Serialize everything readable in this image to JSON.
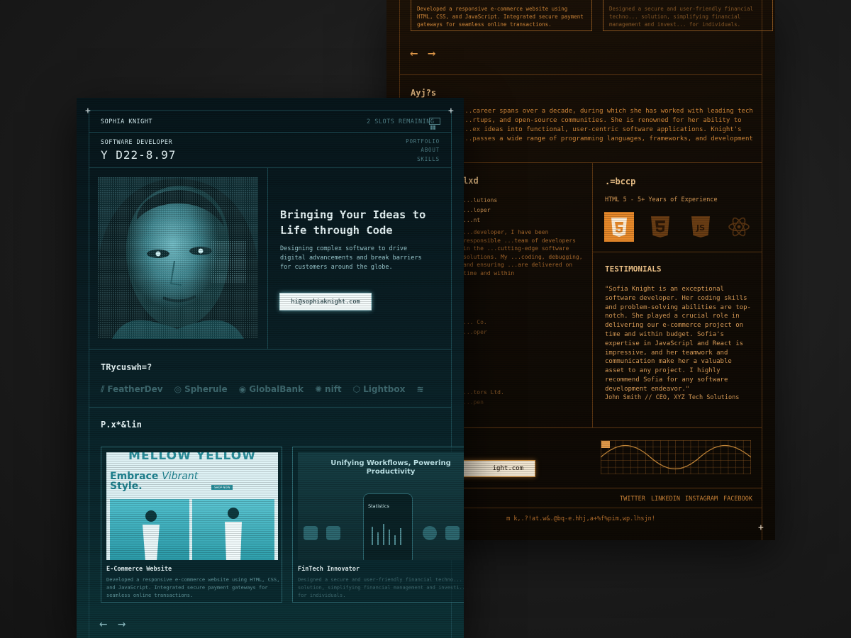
{
  "orange_panel": {
    "cards": [
      {
        "desc": "Developed a responsive e-commerce website using HTML, CSS, and JavaScript. Integrated secure payment gateways for seamless online transactions."
      },
      {
        "desc": "Designed a secure and user-friendly financial techno... solution, simplifying financial management and invest... for individuals."
      }
    ],
    "about_heading": "Ayj?s",
    "about_text": "...career spans over a decade, during which she has worked with leading tech ...rtups, and open-source communities. She is renowned for her ability to ...ex ideas into functional, user-centric software applications. Knight's ...passes a wide range of programming languages, frameworks, and development",
    "experience_heading": "lxd",
    "experience_items": [
      "...lutions",
      "...loper",
      "...nt"
    ],
    "experience_text": "...developer, I have been responsible ...team of developers in the ...cutting-edge software solutions. My ...coding, debugging, and ensuring ...are delivered on time and within",
    "experience_items_2": [
      "... Co.",
      "...oper"
    ],
    "experience_items_3": [
      "...tors Ltd.",
      "...pen"
    ],
    "skills_heading": ".=bccp",
    "skills_sub": "HTML 5 - 5+ Years of Experience",
    "tech_icons": [
      "html5-icon",
      "css3-icon",
      "javascript-icon",
      "react-icon"
    ],
    "testimonials_heading": "TESTIMONIALS",
    "testimonial_text": "\"Sofia Knight is an exceptional software developer. Her coding skills and problem-solving abilities are top-notch. She played a crucial role in delivering our e-commerce project on time and within budget. Sofia's expertise in JavaScripl and React is impressive, and her teamwork and communication make her a valuable asset to any project. I highly recommend Sofia for any software development endeavor.\"",
    "testimonial_author": "John Smith // CEO, XYZ Tech Solutions",
    "email_button": "ight.com",
    "social": [
      "TWITTER",
      "LINKEDIN",
      "INSTAGRAM",
      "FACEBOOK"
    ],
    "footer_text": "m k,.?!at.w&.@bq-e.hhj,a+%f%pim,wp.lhsjn!",
    "accent_color": "#d58a3a"
  },
  "teal_panel": {
    "header": {
      "name": "SOPHIA KNIGHT",
      "slots": "2 SLOTS REMAINING"
    },
    "role": "SOFTWARE DEVELOPER",
    "id_code": "Y D22-8.97",
    "nav": [
      "PORTFOLIO",
      "ABOUT",
      "SKILLS"
    ],
    "hero": {
      "headline": "Bringing Your Ideas to Life through Code",
      "subtitle": "Designing complex software to drive digital advancements and break barriers for customers around the globe.",
      "email_button": "hi@sophiaknight.com"
    },
    "clients_heading": "TRycuswh=?",
    "clients": [
      "FeatherDev",
      "Spherule",
      "GlobalBank",
      "nift",
      "Lightbox"
    ],
    "projects_heading": "P.x*&lin",
    "projects": [
      {
        "title": "E-Commerce Website",
        "desc": "Developed a responsive e-commerce website using HTML, CSS, and JavaScript. Integrated secure payment gateways for seamless online transactions.",
        "thumb_banner": "MELLOW YELLOW",
        "thumb_headline_1": "Embrace",
        "thumb_headline_2": "Vibrant",
        "thumb_headline_3": "Style.",
        "thumb_button": "SHOP NOW"
      },
      {
        "title": "FinTech Innovator",
        "desc": "Designed a secure and user-friendly financial techno... solution, simplifying financial management and investi... for individuals.",
        "thumb_headline": "Unifying Workflows, Powering Productivity",
        "thumb_phone_label": "Statistics"
      }
    ],
    "arrows": [
      "←",
      "→"
    ],
    "accent_color": "#7fd3dc"
  }
}
